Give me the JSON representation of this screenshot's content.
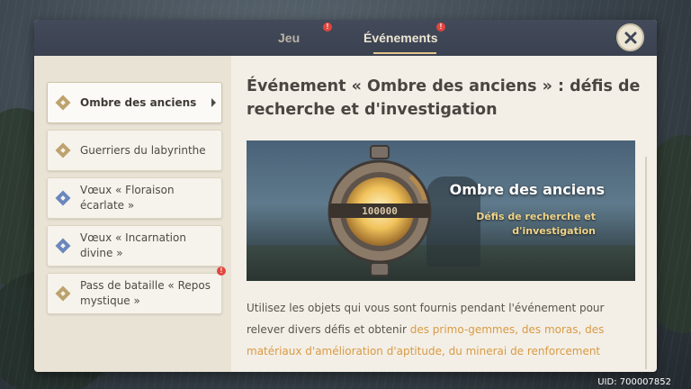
{
  "tabs": [
    {
      "label": "Jeu",
      "badge": "!"
    },
    {
      "label": "Événements",
      "badge": "!"
    }
  ],
  "sidebar": {
    "items": [
      {
        "label": "Ombre des anciens",
        "icon": "gold-diamond-icon"
      },
      {
        "label": "Guerriers du labyrinthe",
        "icon": "gold-diamond-icon"
      },
      {
        "label": "Vœux « Floraison écarlate »",
        "icon": "blue-diamond-icon"
      },
      {
        "label": "Vœux « Incarnation divine »",
        "icon": "blue-diamond-icon"
      },
      {
        "label": "Pass de bataille « Repos mystique »",
        "icon": "gold-diamond-icon",
        "badge": "!"
      }
    ]
  },
  "content": {
    "title": "Événement « Ombre des anciens » : défis de recherche et d'investigation",
    "banner": {
      "title": "Ombre des anciens",
      "subtitle": "Défis de recherche et d'investigation"
    },
    "body_intro": "Utilisez les objets qui vous sont fournis pendant l'événement pour relever divers défis et obtenir ",
    "body_highlight": "des primo-gemmes, des moras, des matériaux d'amélioration d'aptitude, du minerai de renforcement"
  },
  "uid": "UID: 700007852",
  "colors": {
    "accent_gold": "#e3c48a",
    "highlight_orange": "#d99a45",
    "badge_red": "#e0463f"
  }
}
